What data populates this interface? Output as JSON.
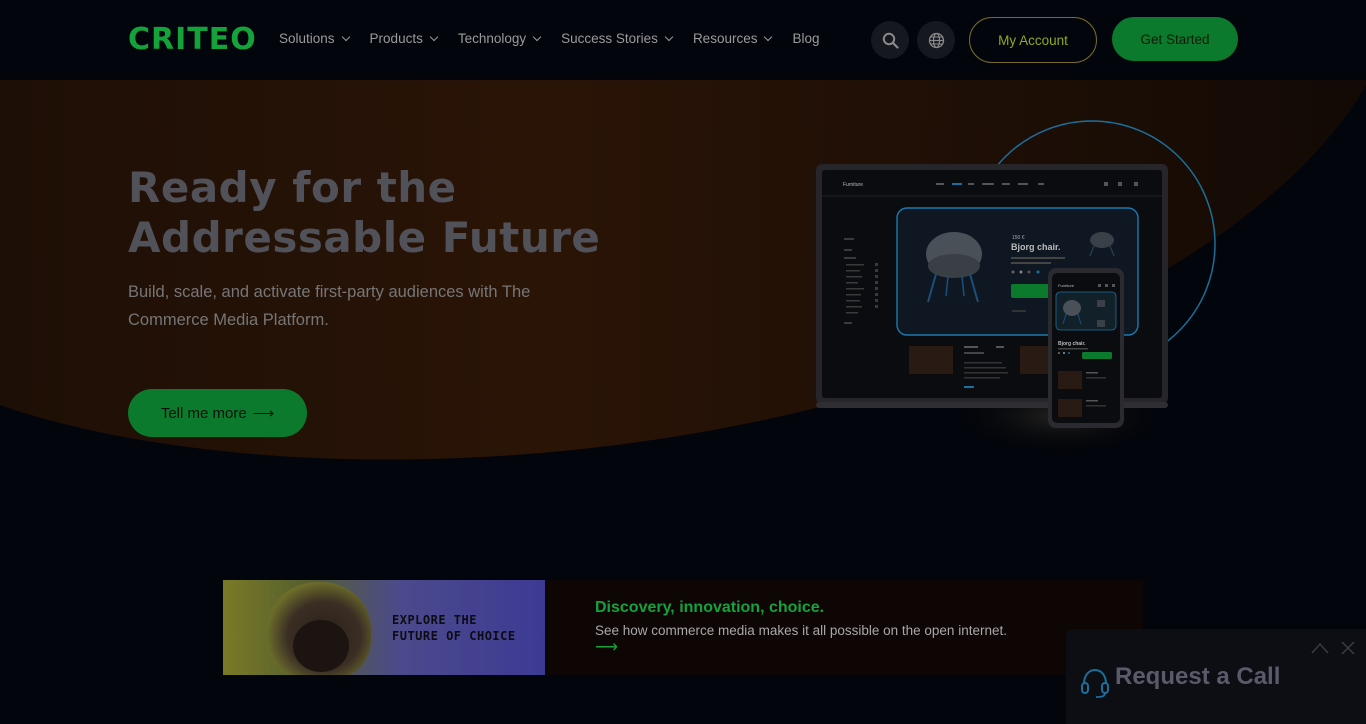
{
  "brand": {
    "logo_text": "CRITEO",
    "accent": "#14a33a"
  },
  "nav": {
    "items": [
      {
        "label": "Solutions",
        "has_dropdown": true
      },
      {
        "label": "Products",
        "has_dropdown": true
      },
      {
        "label": "Technology",
        "has_dropdown": true
      },
      {
        "label": "Success Stories",
        "has_dropdown": true
      },
      {
        "label": "Resources",
        "has_dropdown": true
      },
      {
        "label": "Blog",
        "has_dropdown": false
      }
    ],
    "search_icon": "search-icon",
    "language_icon": "globe-icon",
    "account_label": "My Account",
    "cta_label": "Get Started"
  },
  "hero": {
    "title_line1": "Ready for the",
    "title_line2": "Addressable Future",
    "subtitle": "Build, scale, and activate first-party audiences with The Commerce Media Platform.",
    "cta_label": "Tell me more",
    "cta_arrow": "⟶"
  },
  "mockup": {
    "desktop_brand": "Furniture",
    "product_price": "150 €",
    "product_name": "Bjorg chair.",
    "mobile_brand": "Furniture",
    "mobile_product_name": "Bjorg chair."
  },
  "promo": {
    "image_caption_line1": "EXPLORE THE",
    "image_caption_line2": "FUTURE OF CHOICE",
    "title": "Discovery, innovation, choice.",
    "description": "See how commerce media makes it all possible on the open internet.",
    "arrow": "⟶"
  },
  "request_call": {
    "label": "Request a Call",
    "icon": "headset-icon"
  }
}
